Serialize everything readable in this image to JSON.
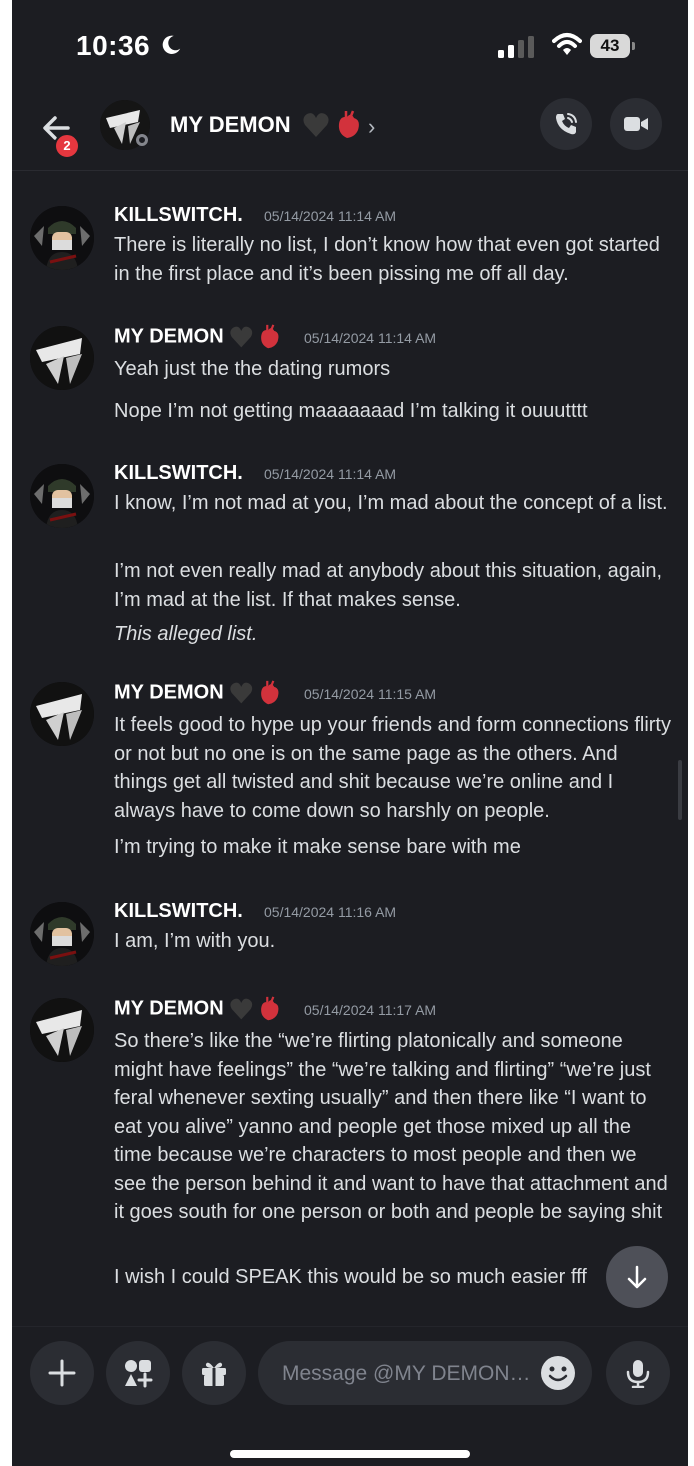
{
  "status_bar": {
    "time": "10:36",
    "battery": "43"
  },
  "header": {
    "back_badge": "2",
    "name": "MY DEMON",
    "chevron": "›"
  },
  "messages": [
    {
      "author": "KILLSWITCH.",
      "timestamp": "05/14/2024 11:14 AM",
      "lines": [
        "There is literally no list, I don’t know how that even got started in the first place and it’s been pissing me off all day."
      ]
    },
    {
      "author": "MY DEMON",
      "timestamp": "05/14/2024 11:14 AM",
      "lines": [
        "Yeah just the the dating rumors",
        "Nope I’m not getting maaaaaaad I’m talking it ouuutttt"
      ]
    },
    {
      "author": "KILLSWITCH.",
      "timestamp": "05/14/2024 11:14 AM",
      "lines": [
        "I know, I’m not mad at you, I’m mad about the concept of a list.",
        "I’m not even really mad at anybody about this situation, again, I’m mad at the list. If that makes sense.",
        "This alleged list."
      ]
    },
    {
      "author": "MY DEMON",
      "timestamp": "05/14/2024 11:15 AM",
      "lines": [
        "It feels good to hype up your friends and form connections flirty or not but no one is on the same page as the others. And things get all twisted and shit because we’re online and I always have to come down so harshly on people.",
        "I’m trying to make it make sense bare with me"
      ]
    },
    {
      "author": "KILLSWITCH.",
      "timestamp": "05/14/2024 11:16 AM",
      "lines": [
        "I am, I’m with you."
      ]
    },
    {
      "author": "MY DEMON",
      "timestamp": "05/14/2024 11:17 AM",
      "lines": [
        "So there’s like the “we’re flirting platonically and someone might have feelings” the “we’re talking and flirting” “we’re just feral whenever sexting usually” and then there like “I want to eat you alive” yanno and people get those mixed up all the time because we’re characters to most people and then we see the person behind it and want to have that attachment and it goes south for one person or both and people be saying shit",
        "I wish I could SPEAK this would be so much easier fff"
      ]
    }
  ],
  "composer": {
    "placeholder": "Message @MY DEMON…"
  },
  "icons": {
    "moon": "moon-icon",
    "signal": "cellular-signal-icon",
    "wifi": "wifi-icon",
    "back": "back-arrow-icon",
    "call": "phone-call-icon",
    "video": "video-camera-icon",
    "jump": "arrow-down-icon",
    "plus": "plus-icon",
    "apps": "apps-icon",
    "gift": "gift-icon",
    "emoji": "emoji-icon",
    "mic": "microphone-icon",
    "hearts": "black-heart-and-anatomical-heart-icon"
  },
  "colors": {
    "background": "#1c1d22",
    "badge": "#e5373f",
    "button": "#2b2d33",
    "text": "#dbdee1",
    "muted": "#949ba4"
  }
}
